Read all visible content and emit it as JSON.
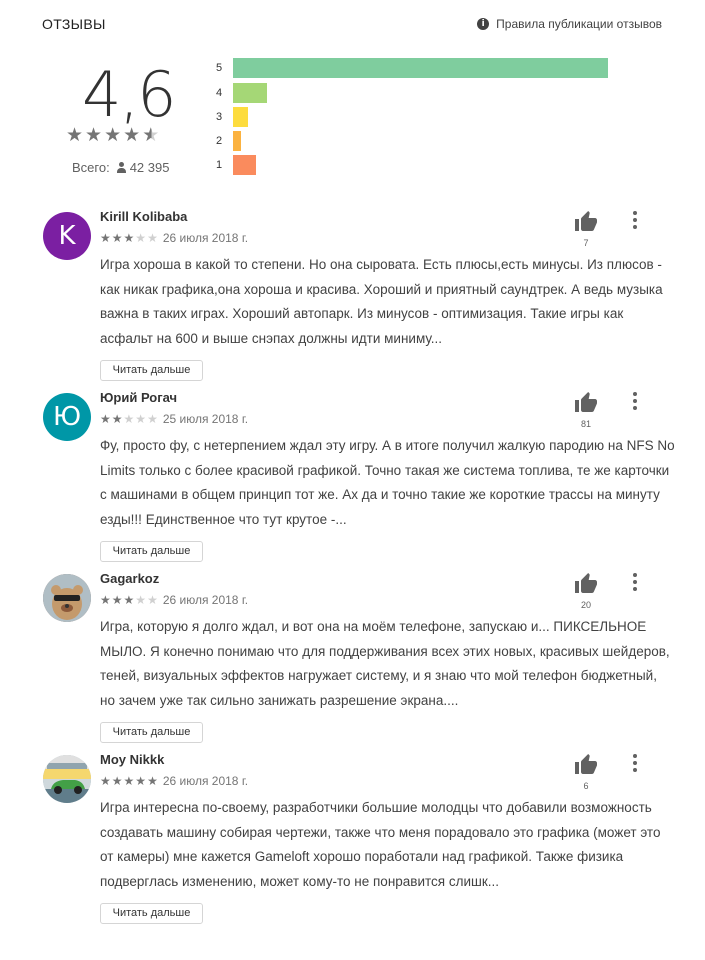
{
  "header": {
    "title": "ОТЗЫВЫ",
    "policy_link": "Правила публикации отзывов",
    "info_icon": "info-icon"
  },
  "summary": {
    "rating": "4,6",
    "stars": "★★★★★",
    "stars_value": 4.5,
    "total_label": "Всего:",
    "total_count": "42 395"
  },
  "histogram": [
    {
      "label": "5",
      "fraction": 1.0,
      "color": "#7fcd9e"
    },
    {
      "label": "4",
      "fraction": 0.09,
      "color": "#a5d776"
    },
    {
      "label": "3",
      "fraction": 0.04,
      "color": "#fddc3e"
    },
    {
      "label": "2",
      "fraction": 0.02,
      "color": "#fbb240"
    },
    {
      "label": "1",
      "fraction": 0.06,
      "color": "#fa8b5d"
    }
  ],
  "reviews": [
    {
      "author": "Kirill Kolibaba",
      "avatar_letter": "K",
      "avatar_color": "#7b1fa2",
      "rating": 3,
      "date": "26 июля 2018 г.",
      "likes": "7",
      "text": "Игра хороша в какой то степени. Но она сыровата. Есть плюсы,есть минусы. Из плюсов - как никак графика,она хороша и красива. Хороший и приятный саундтрек. А ведь музыка важна в таких играх. Хороший автопарк. Из минусов - оптимизация. Такие игры как асфальт на 600 и выше снэпах должны идти миниму...",
      "read_more": "Читать дальше"
    },
    {
      "author": "Юрий Рогач",
      "avatar_letter": "Ю",
      "avatar_color": "#0097a7",
      "rating": 2,
      "date": "25 июля 2018 г.",
      "likes": "81",
      "text": "Фу, просто фу, с нетерпением ждал эту игру. А в итоге получил жалкую пародию на NFS No Limits только с более красивой графикой. Точно такая же система топлива, те же карточки с машинами в общем принцип тот же. Ах да и точно такие же короткие трассы на минуту езды!!! Единственное что тут крутое -...",
      "read_more": "Читать дальше"
    },
    {
      "author": "Gagarkoz",
      "avatar_letter": "",
      "avatar_color": "#8d6e63",
      "rating": 3,
      "date": "26 июля 2018 г.",
      "likes": "20",
      "text": "Игра, которую я долго ждал, и вот она на моём телефоне, запускаю и... ПИКСЕЛЬНОЕ МЫЛО. Я конечно понимаю что для поддерживания всех этих новых, красивых шейдеров, теней, визуальных эффектов нагружает систему, и я знаю что мой телефон бюджетный, но зачем уже так сильно занижать разрешение экрана....",
      "read_more": "Читать дальше"
    },
    {
      "author": "Moy Nikkk",
      "avatar_letter": "",
      "avatar_color": "#90a4ae",
      "rating": 5,
      "date": "26 июля 2018 г.",
      "likes": "6",
      "text": "Игра интересна по-своему, разработчики большие молодцы что добавили возможность создавать машину собирая чертежи, также что меня порадовало это графика (может это от камеры) мне кажется Gameloft хорошо поработали над графикой. Также физика подверглась изменению, может кому-то не понравится слишк...",
      "read_more": "Читать дальше"
    }
  ]
}
